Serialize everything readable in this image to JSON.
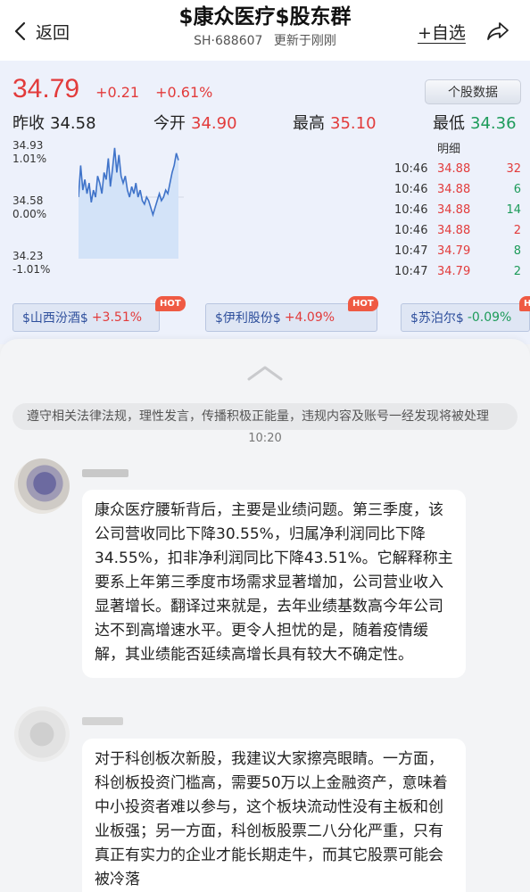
{
  "header": {
    "back_label": "返回",
    "title": "$康众医疗$股东群",
    "code": "SH·688607",
    "updated": "更新于刚刚",
    "watch_label": "+自选"
  },
  "quote": {
    "price": "34.79",
    "change": "+0.21",
    "change_pct": "+0.61%",
    "data_button": "个股数据",
    "stats": [
      {
        "label": "昨收",
        "value": "34.58"
      },
      {
        "label": "今开",
        "value": "34.90"
      },
      {
        "label": "最高",
        "value": "35.10"
      },
      {
        "label": "最低",
        "value": "34.36"
      }
    ],
    "axis": {
      "top_price": "34.93",
      "top_pct": "1.01%",
      "mid_price": "34.58",
      "mid_pct": "0.00%",
      "bot_price": "34.23",
      "bot_pct": "-1.01%"
    },
    "detail_title": "明细",
    "trades": [
      {
        "time": "10:46",
        "price": "34.88",
        "qty": "32",
        "side": "buy"
      },
      {
        "time": "10:46",
        "price": "34.88",
        "qty": "6",
        "side": "sell"
      },
      {
        "time": "10:46",
        "price": "34.88",
        "qty": "14",
        "side": "sell"
      },
      {
        "time": "10:46",
        "price": "34.88",
        "qty": "2",
        "side": "buy"
      },
      {
        "time": "10:47",
        "price": "34.79",
        "qty": "8",
        "side": "sell"
      },
      {
        "time": "10:47",
        "price": "34.79",
        "qty": "2",
        "side": "sell"
      }
    ],
    "related": [
      {
        "name": "$山西汾酒$",
        "pct": "+3.51%",
        "hot": "HOT",
        "dir": "up"
      },
      {
        "name": "$伊利股份$",
        "pct": "+4.09%",
        "hot": "HOT",
        "dir": "up"
      },
      {
        "name": "$苏泊尔$",
        "pct": "-0.09%",
        "hot": "HOT",
        "dir": "down"
      }
    ],
    "intraday": [
      34.58,
      34.76,
      34.62,
      34.68,
      34.6,
      34.66,
      34.55,
      34.62,
      34.58,
      34.7,
      34.66,
      34.6,
      34.72,
      34.68,
      34.8,
      34.64,
      34.74,
      34.86,
      34.72,
      34.82,
      34.7,
      34.66,
      34.7,
      34.62,
      34.58,
      34.64,
      34.6,
      34.66,
      34.58,
      34.62,
      34.56,
      34.54,
      34.58,
      34.56,
      34.52,
      34.48,
      34.52,
      34.56,
      34.6,
      34.56,
      34.58,
      34.62,
      34.6,
      34.66,
      34.72,
      34.76,
      34.83,
      34.79
    ]
  },
  "chat": {
    "notice": "遵守相关法律法规，理性发言，传播积极正能量，违规内容及账号一经发现将被处理",
    "time": "10:20",
    "messages": [
      {
        "text": "康众医疗腰斩背后，主要是业绩问题。第三季度，该公司营收同比下降30.55%，归属净利润同比下降34.55%，扣非净利润同比下降43.51%。它解释称主要系上年第三季度市场需求显著增加，公司营业收入显著增长。翻译过来就是，去年业绩基数高今年公司达不到高增速水平。更令人担忧的是，随着疫情缓解，其业绩能否延续高增长具有较大不确定性。"
      },
      {
        "text": "对于科创板次新股，我建议大家擦亮眼睛。一方面，科创板投资门槛高，需要50万以上金融资产，意味着中小投资者难以参与，这个板块流动性没有主板和创业板强；另一方面，科创板股票二八分化严重，只有真正有实力的企业才能长期走牛，而其它股票可能会被冷落"
      }
    ]
  }
}
